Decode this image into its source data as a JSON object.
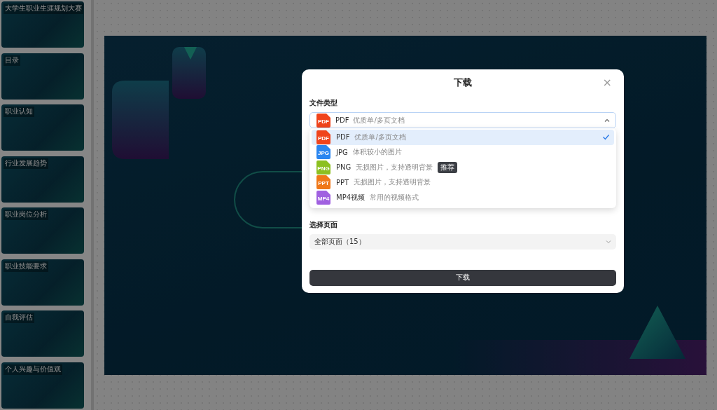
{
  "sidebar": {
    "slides": [
      {
        "title": "大学生职业生涯规划大赛"
      },
      {
        "title": "目录"
      },
      {
        "title": "职业认知"
      },
      {
        "title": "行业发展趋势"
      },
      {
        "title": "职业岗位分析"
      },
      {
        "title": "职业技能要求"
      },
      {
        "title": "自我评估"
      },
      {
        "title": "个人兴趣与价值观"
      }
    ]
  },
  "dialog": {
    "title": "下载",
    "close": "×",
    "file_type_label": "文件类型",
    "file_type": {
      "expanded": true,
      "format": "PDF",
      "description": "优质单/多页文档",
      "icon_label": "PDF",
      "color": "#f0441c"
    },
    "options": [
      {
        "format": "PDF",
        "description": "优质单/多页文档",
        "icon_label": "PDF",
        "color": "#f0441c",
        "selected": true
      },
      {
        "format": "JPG",
        "description": "体积较小的图片",
        "icon_label": "JPG",
        "color": "#2a86f0",
        "selected": false
      },
      {
        "format": "PNG",
        "description": "无损图片，支持透明背景",
        "badge": "推荐",
        "icon_label": "PNG",
        "color": "#8cc020",
        "selected": false
      },
      {
        "format": "PPT",
        "description": "无损图片，支持透明背景",
        "icon_label": "PPT",
        "color": "#f07818",
        "selected": false
      },
      {
        "format": "MP4视频",
        "description": "常用的视频格式",
        "icon_label": "MP4",
        "color": "#a060e0",
        "selected": false
      }
    ],
    "pages_label": "选择页面",
    "pages_value": "全部页面（15）",
    "download_button": "下载"
  }
}
